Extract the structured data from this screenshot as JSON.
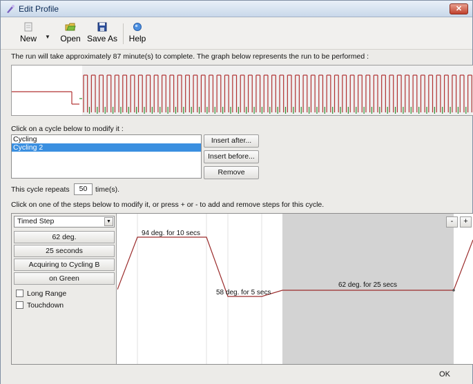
{
  "window": {
    "title": "Edit Profile",
    "close_label": "✕"
  },
  "toolbar": {
    "new_label": "New",
    "open_label": "Open",
    "save_as_label": "Save As",
    "help_label": "Help",
    "icons": {
      "new": "new-document-icon",
      "open": "open-folder-icon",
      "save_as": "floppy-disk-icon",
      "help": "help-icon"
    }
  },
  "run_info": "The run will take approximately 87 minute(s) to complete. The graph below represents the run to be performed :",
  "cycle_section": {
    "label": "Click on a cycle below to modify it :",
    "items": [
      {
        "label": "Cycling",
        "selected": false
      },
      {
        "label": "Cycling 2",
        "selected": true
      }
    ],
    "insert_after_label": "Insert after...",
    "insert_before_label": "Insert before...",
    "remove_label": "Remove"
  },
  "repeats": {
    "prefix": "This cycle repeats",
    "value": "50",
    "suffix": "time(s)."
  },
  "steps_instruction": "Click on one of the steps below to modify it, or press + or - to add and remove steps for this cycle.",
  "step_editor": {
    "step_type": "Timed Step",
    "temperature": "62 deg.",
    "duration": "25 seconds",
    "acquiring": "Acquiring to Cycling B",
    "channel": "on Green",
    "long_range_label": "Long Range",
    "touchdown_label": "Touchdown",
    "long_range_checked": false,
    "touchdown_checked": false
  },
  "step_graph": {
    "minus_label": "-",
    "plus_label": "+",
    "steps": [
      {
        "label": "94 deg. for 10 secs",
        "temp": 94,
        "secs": 10,
        "selected": false
      },
      {
        "label": "58 deg. for 5 secs",
        "temp": 58,
        "secs": 5,
        "selected": false
      },
      {
        "label": "62 deg. for 25 secs",
        "temp": 62,
        "secs": 25,
        "selected": true
      }
    ],
    "line_color": "#9a2a2a",
    "selected_bg": "#d3d3d3"
  },
  "ok_label": "OK",
  "colors": {
    "overview_red": "#b03030",
    "overview_green": "#2e8b2e",
    "selection_blue": "#3a8fe0"
  }
}
